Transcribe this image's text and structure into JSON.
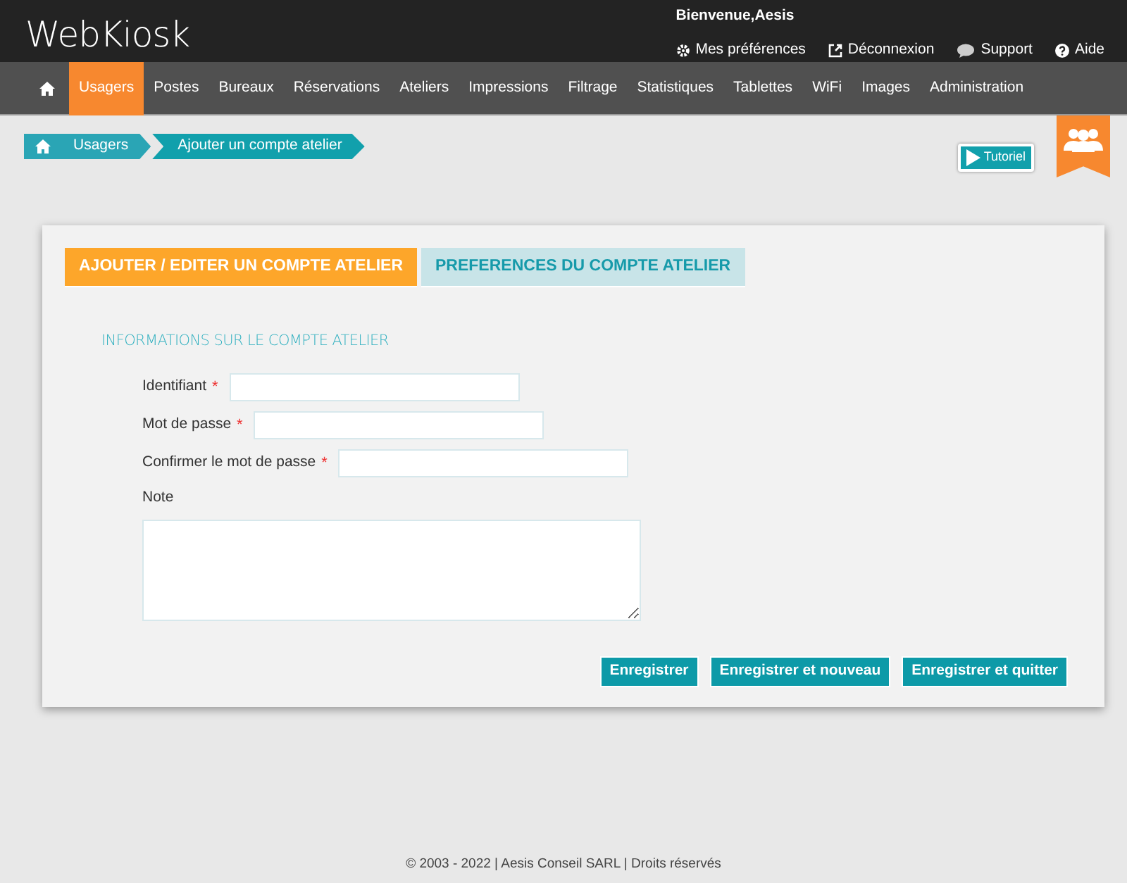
{
  "header": {
    "logo": "WebKiosk",
    "welcome": "Bienvenue,Aesis",
    "links": [
      {
        "kind": "gear",
        "label": "Mes préférences"
      },
      {
        "kind": "exit",
        "label": "Déconnexion"
      },
      {
        "kind": "chat",
        "label": "Support"
      },
      {
        "kind": "help",
        "label": "Aide"
      }
    ]
  },
  "nav": [
    {
      "label": "Usagers",
      "selected": true
    },
    {
      "label": "Postes",
      "selected": false
    },
    {
      "label": "Bureaux",
      "selected": false
    },
    {
      "label": "Réservations",
      "selected": false
    },
    {
      "label": "Ateliers",
      "selected": false
    },
    {
      "label": "Impressions",
      "selected": false
    },
    {
      "label": "Filtrage",
      "selected": false
    },
    {
      "label": "Statistiques",
      "selected": false
    },
    {
      "label": "Tablettes",
      "selected": false
    },
    {
      "label": "WiFi",
      "selected": false
    },
    {
      "label": "Images",
      "selected": false
    },
    {
      "label": "Administration",
      "selected": false
    }
  ],
  "breadcrumb": [
    "Usagers",
    "Ajouter un compte atelier"
  ],
  "tutorial": "Tutoriel",
  "tabs": [
    {
      "label": "AJOUTER / EDITER UN COMPTE ATELIER",
      "selected": true
    },
    {
      "label": "PREFERENCES DU COMPTE ATELIER",
      "selected": false
    }
  ],
  "section_title": "INFORMATIONS SUR LE COMPTE ATELIER",
  "fields": [
    {
      "kind": "input",
      "label": "Identifiant",
      "required": true
    },
    {
      "kind": "input",
      "label": "Mot de passe",
      "required": true
    },
    {
      "kind": "input",
      "label": "Confirmer le mot de passe",
      "required": true
    },
    {
      "kind": "textarea",
      "label": "Note",
      "required": false
    }
  ],
  "required_mark": "*",
  "buttons": [
    "Enregistrer",
    "Enregistrer et nouveau",
    "Enregistrer et quitter"
  ],
  "footer": "© 2003 - 2022 | Aesis Conseil SARL | Droits réservés"
}
